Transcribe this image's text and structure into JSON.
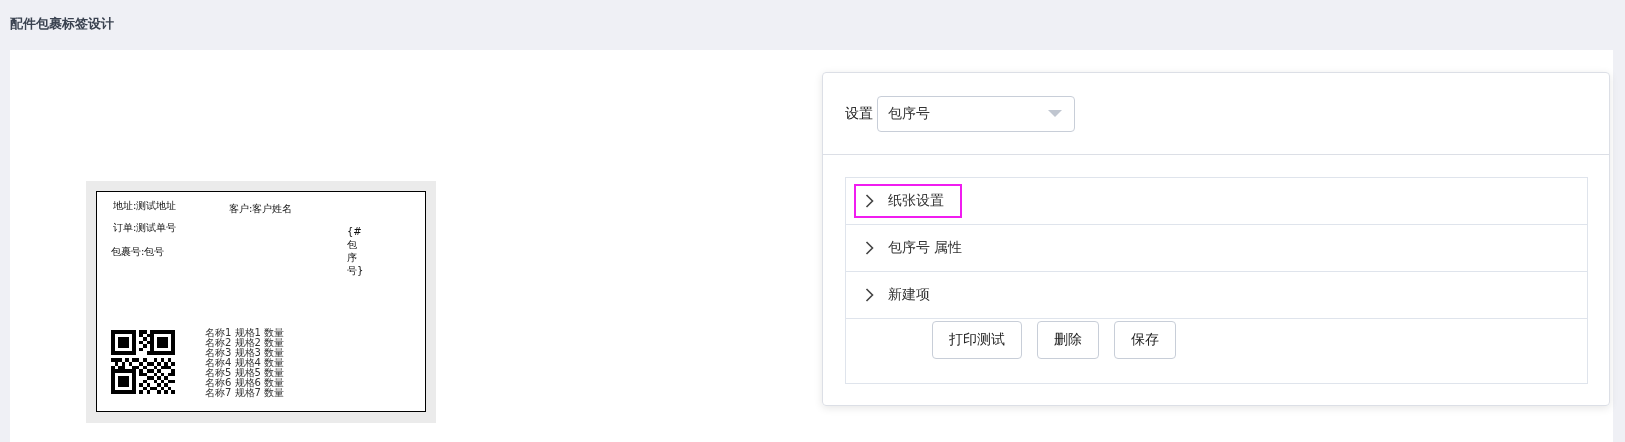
{
  "page_title": "配件包裹标签设计",
  "label_preview": {
    "fields": [
      {
        "kind": "text",
        "text": "地址:测试地址"
      },
      {
        "kind": "text",
        "text": "客户:客户姓名"
      },
      {
        "kind": "text",
        "text": "订单:测试单号"
      },
      {
        "kind": "text",
        "text": "包裹号:包号"
      },
      {
        "kind": "vertical",
        "text": "{#包序号}"
      },
      {
        "kind": "qrcode"
      },
      {
        "kind": "list",
        "lines": [
          "名称1 规格1 数量",
          "名称2 规格2 数量",
          "名称3 规格3 数量",
          "名称4 规格4 数量",
          "名称5 规格5 数量",
          "名称6 规格6 数量",
          "名称7 规格7 数量"
        ]
      }
    ]
  },
  "settings": {
    "label": "设置",
    "select_value": "包序号",
    "sections": [
      {
        "title": "纸张设置",
        "expanded": false,
        "highlighted": true
      },
      {
        "title": "包序号 属性",
        "expanded": false,
        "highlighted": false
      },
      {
        "title": "新建项",
        "expanded": false,
        "highlighted": false
      }
    ],
    "buttons": [
      "打印测试",
      "删除",
      "保存"
    ]
  }
}
